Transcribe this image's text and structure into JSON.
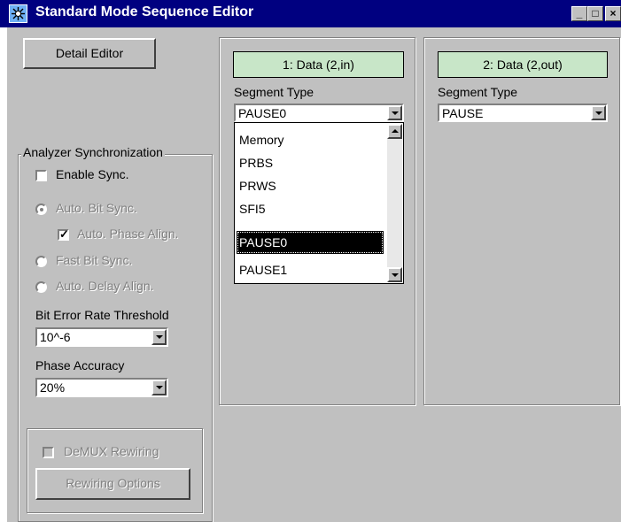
{
  "window": {
    "title": "Standard Mode Sequence Editor",
    "minimize": "_",
    "maximize": "□",
    "close": "×"
  },
  "left": {
    "detail_editor": "Detail Editor",
    "group_title": "Analyzer Synchronization",
    "enable_sync": "Enable Sync.",
    "auto_bit_sync": "Auto. Bit Sync.",
    "auto_phase_align": "Auto. Phase Align.",
    "fast_bit_sync": "Fast Bit Sync.",
    "auto_delay_align": "Auto. Delay Align.",
    "ber_label": "Bit Error Rate Threshold",
    "ber_value": "10^-6",
    "phase_label": "Phase Accuracy",
    "phase_value": "20%",
    "demux_rewiring": "DeMUX Rewiring",
    "rewiring_options": "Rewiring Options"
  },
  "segments": [
    {
      "header": "1: Data  (2,in)",
      "type_label": "Segment Type",
      "type_value": "PAUSE0",
      "options": [
        "Memory",
        "PRBS",
        "PRWS",
        "SFI5",
        "PAUSE0",
        "PAUSE1"
      ],
      "selected": "PAUSE0"
    },
    {
      "header": "2: Data  (2,out)",
      "type_label": "Segment Type",
      "type_value": "PAUSE"
    }
  ]
}
